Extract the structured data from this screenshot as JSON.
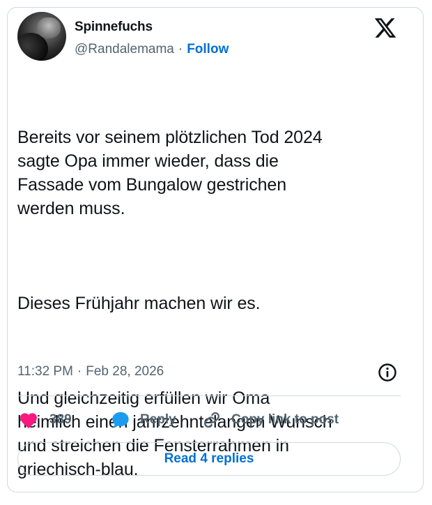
{
  "author": {
    "name": "Spinnefuchs",
    "handle": "@Randalemama",
    "separator": "·",
    "follow_label": "Follow"
  },
  "tweet": {
    "paragraphs": [
      "Bereits vor seinem plötzlichen Tod 2024\nsagte Opa immer wieder, dass die\nFassade vom Bungalow gestrichen\nwerden muss.",
      "Dieses Frühjahr machen wir es.",
      "Und gleichzeitig erfüllen wir Oma\nheimlich einen jahrzehntelangen Wunsch\nund streichen die Fensterrahmen in\ngriechisch-blau."
    ],
    "time": "11:32 PM",
    "separator": "·",
    "date": "Feb 28, 2026"
  },
  "actions": {
    "like_count": "389",
    "reply_label": "Reply",
    "copy_label": "Copy link to post"
  },
  "read_replies_label": "Read 4 replies",
  "icons": {
    "brand": "x-logo-icon",
    "info": "info-icon",
    "like": "heart-icon",
    "reply": "speech-bubble-icon",
    "copy": "link-icon"
  },
  "colors": {
    "accent": "#006fd6",
    "like": "#f91880",
    "reply": "#1d9bf0",
    "text": "#0f1419",
    "secondary": "#536471",
    "border": "#cfd9de"
  }
}
